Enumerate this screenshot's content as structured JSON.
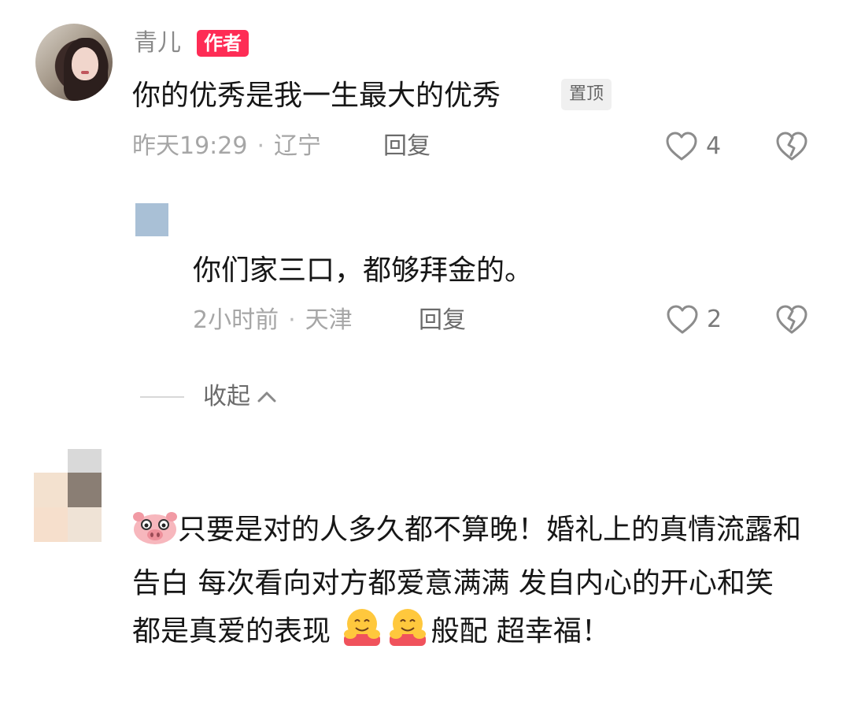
{
  "comment": {
    "username": "青儿",
    "author_badge": "作者",
    "text": "你的优秀是我一生最大的优秀",
    "pinned_label": "置顶",
    "time": "昨天19:29",
    "location": "辽宁",
    "reply_label": "回复",
    "likes": "4"
  },
  "reply": {
    "text": "你们家三口，都够拜金的。",
    "time": "2小时前",
    "location": "天津",
    "reply_label": "回复",
    "likes": "2"
  },
  "collapse_label": "收起",
  "comment2": {
    "part1": "只要是对的人多久都不算晚！婚礼上的真情流露和告白 每次看向对方都爱意满满 发自内心的开心和笑 都是真爱的表现 ",
    "part2": "般配 超幸福！"
  },
  "icons": {
    "heart": "heart-outline-icon",
    "dislike": "broken-heart-icon",
    "collapse": "chevron-up-icon",
    "pig": "pig-face-emoji",
    "hug": "hugging-face-emoji"
  },
  "colors": {
    "author_badge": "#fe2c55",
    "meta_text": "#a6a6a6",
    "body_text": "#161616"
  }
}
